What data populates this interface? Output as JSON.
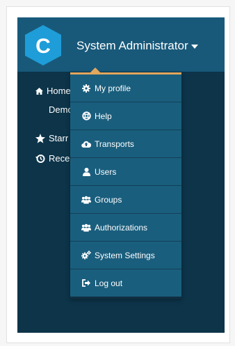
{
  "header": {
    "logo_letter": "C",
    "user_name": "System Administrator"
  },
  "sidebar": {
    "items": [
      {
        "label": "Home",
        "icon": "home-icon"
      },
      {
        "label": "Demo",
        "icon": ""
      },
      {
        "label": "Starr",
        "icon": "star-icon"
      },
      {
        "label": "Rece",
        "icon": "history-icon"
      }
    ]
  },
  "user_menu": {
    "items": [
      {
        "label": "My profile",
        "icon": "gear-icon"
      },
      {
        "label": "Help",
        "icon": "lifebuoy-icon"
      },
      {
        "label": "Transports",
        "icon": "cloud-upload-icon"
      },
      {
        "label": "Users",
        "icon": "user-icon"
      },
      {
        "label": "Groups",
        "icon": "users-icon"
      },
      {
        "label": "Authorizations",
        "icon": "users-icon"
      },
      {
        "label": "System Settings",
        "icon": "gears-icon"
      },
      {
        "label": "Log out",
        "icon": "sign-out-icon"
      }
    ]
  },
  "colors": {
    "header_bg": "#18597a",
    "body_bg": "#0d3449",
    "menu_bg": "#1a5e7d",
    "accent": "#e2a75d",
    "logo": "#1e9dd8"
  }
}
